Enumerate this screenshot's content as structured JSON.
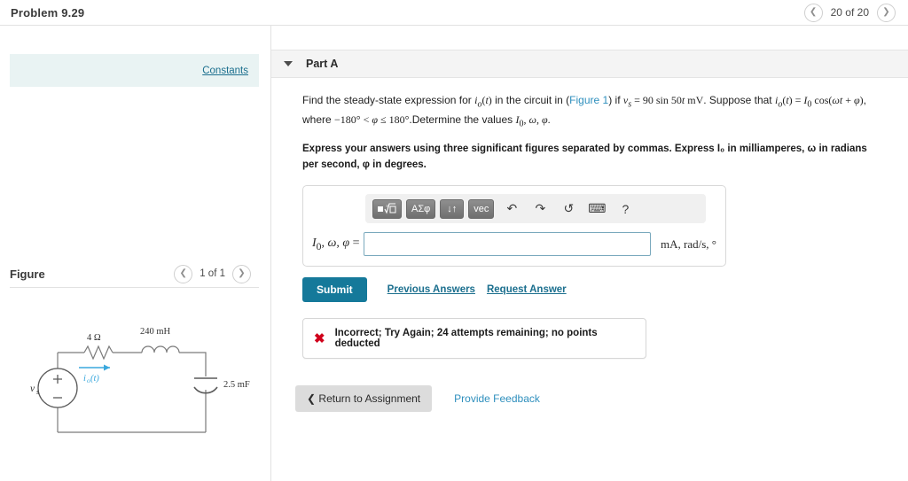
{
  "header": {
    "problem_title": "Problem 9.29",
    "pager_label": "20 of 20",
    "prev_icon": "chevron-left-icon",
    "next_icon": "chevron-right-icon"
  },
  "left_panel": {
    "constants_label": "Constants",
    "figure_title": "Figure",
    "figure_pager_label": "1 of 1"
  },
  "part_a": {
    "label": "Part A",
    "statement_line1": "Find the steady-state expression for ",
    "figure_link": "Figure 1",
    "instruction": "Express your answers using three significant figures separated by commas. Express I₀ in milliamperes, ω in radians per second, φ in degrees.",
    "toolbar": {
      "template_label": "√",
      "symbols_label": "ΑΣφ",
      "arrows_label": "↓↑",
      "vec_label": "vec",
      "undo_label": "↶",
      "redo_label": "↷",
      "reset_label": "↺",
      "keyboard_label": "⌨",
      "help_label": "?"
    },
    "answer_label": "I₀, ω, φ =",
    "answer_value": "",
    "answer_placeholder": "",
    "answer_units": "mA, rad/s, °",
    "submit_label": "Submit",
    "previous_answers_label": "Previous Answers",
    "request_answer_label": "Request Answer",
    "feedback_icon": "error-cross-icon",
    "feedback_text": "Incorrect; Try Again; 24 attempts remaining; no points deducted"
  },
  "bottom": {
    "return_label": "Return to Assignment",
    "return_icon": "chevron-left-icon",
    "feedback_label": "Provide Feedback"
  },
  "figure": {
    "source_label": "vₛ",
    "source_plus": "+",
    "source_minus": "−",
    "resistor_label": "4 Ω",
    "inductor_label": "240 mH",
    "capacitor_label": "2.5 mF",
    "current_label": "iₒ(t)",
    "current_color": "#3aa8dd",
    "wire_color": "#7a7a7a"
  },
  "colors": {
    "accent": "#15799a",
    "link": "#1b6f8e",
    "error": "#d0011b",
    "constants_bg": "#e9f3f3"
  }
}
